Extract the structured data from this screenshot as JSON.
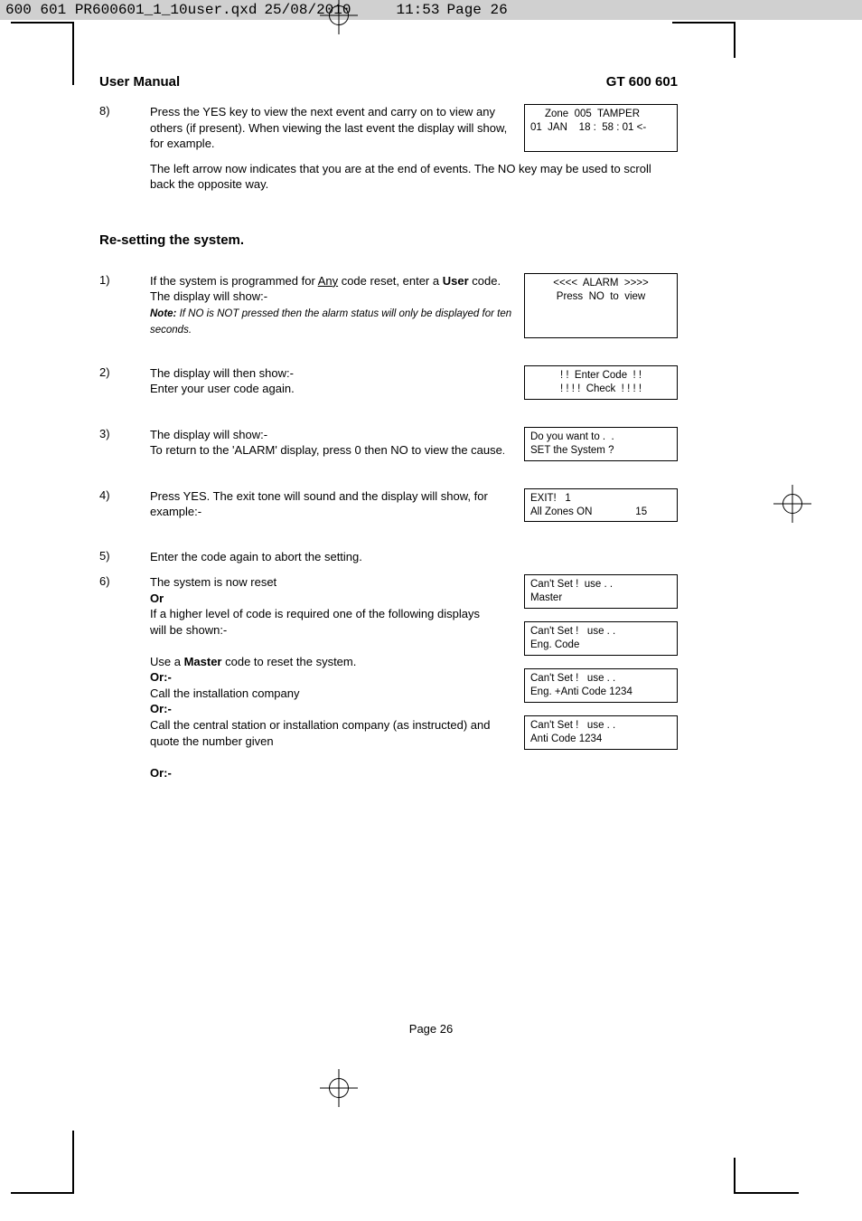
{
  "slug": {
    "filename": "600 601 PR600601_1_10user.qxd",
    "date": "25/08/2010",
    "time": "11:53",
    "pagelabel": "Page 26"
  },
  "header": {
    "left": "User Manual",
    "right": "GT 600 601"
  },
  "step8": {
    "num": "8)",
    "para1": "Press the YES key to view the next event and carry on to view any others (if present). When viewing the last event the display will show, for example.",
    "para2": "The left arrow now indicates that you are at the end of events. The NO key may be used to scroll back the opposite way.",
    "lcd": "     Zone  005  TAMPER\n01  JAN    18 :  58 : 01 <-"
  },
  "section_title": "Re-setting the system.",
  "resteps": {
    "s1": {
      "num": "1)",
      "text_a": "If the system is programmed for ",
      "text_a_u": "Any",
      "text_a2": " code reset, enter a ",
      "text_a_b": "User",
      "text_a3": " code. The display will show:-",
      "note": " If NO is NOT pressed then the alarm status will only be displayed for ten seconds",
      "lcd": "<<<<  ALARM  >>>>\nPress  NO  to  view"
    },
    "s2": {
      "num": "2)",
      "text": "The display will then show:-\nEnter your user code again.",
      "lcd": "! !  Enter Code  ! !\n! ! ! !  Check  ! ! ! !"
    },
    "s3": {
      "num": "3)",
      "text": "The display will show:-\nTo return to the 'ALARM' display, press 0 then NO to view the cause",
      "lcd": "Do you want to .  .\nSET the System ?"
    },
    "s4": {
      "num": "4)",
      "text": "Press YES. The exit tone will sound and the display will show, for example:-",
      "lcd": "EXIT!   1\nAll Zones ON               15"
    },
    "s5": {
      "num": "5)",
      "text": "Enter the code again to abort the setting."
    },
    "s6": {
      "num": "6)",
      "line1": "The system is now reset",
      "or": "Or",
      "line2": "If a higher level of code is required one of the following displays will be shown:-",
      "line3a": "Use a ",
      "line3b": "Master",
      "line3c": " code to reset the system.",
      "or2": "Or:-",
      "line4": "Call the installation company",
      "or3": "Or:-",
      "line5": "Call the central station or installation company (as instructed) and quote the number given",
      "or4": "Or:-",
      "lcd1": "Can't Set !  use . .\nMaster",
      "lcd2": "Can't Set !   use . .\nEng. Code",
      "lcd3": "Can't Set !   use . .\nEng. +Anti Code 1234",
      "lcd4": "Can't Set !   use . .\nAnti Code 1234"
    }
  },
  "page_number": "Page  26"
}
